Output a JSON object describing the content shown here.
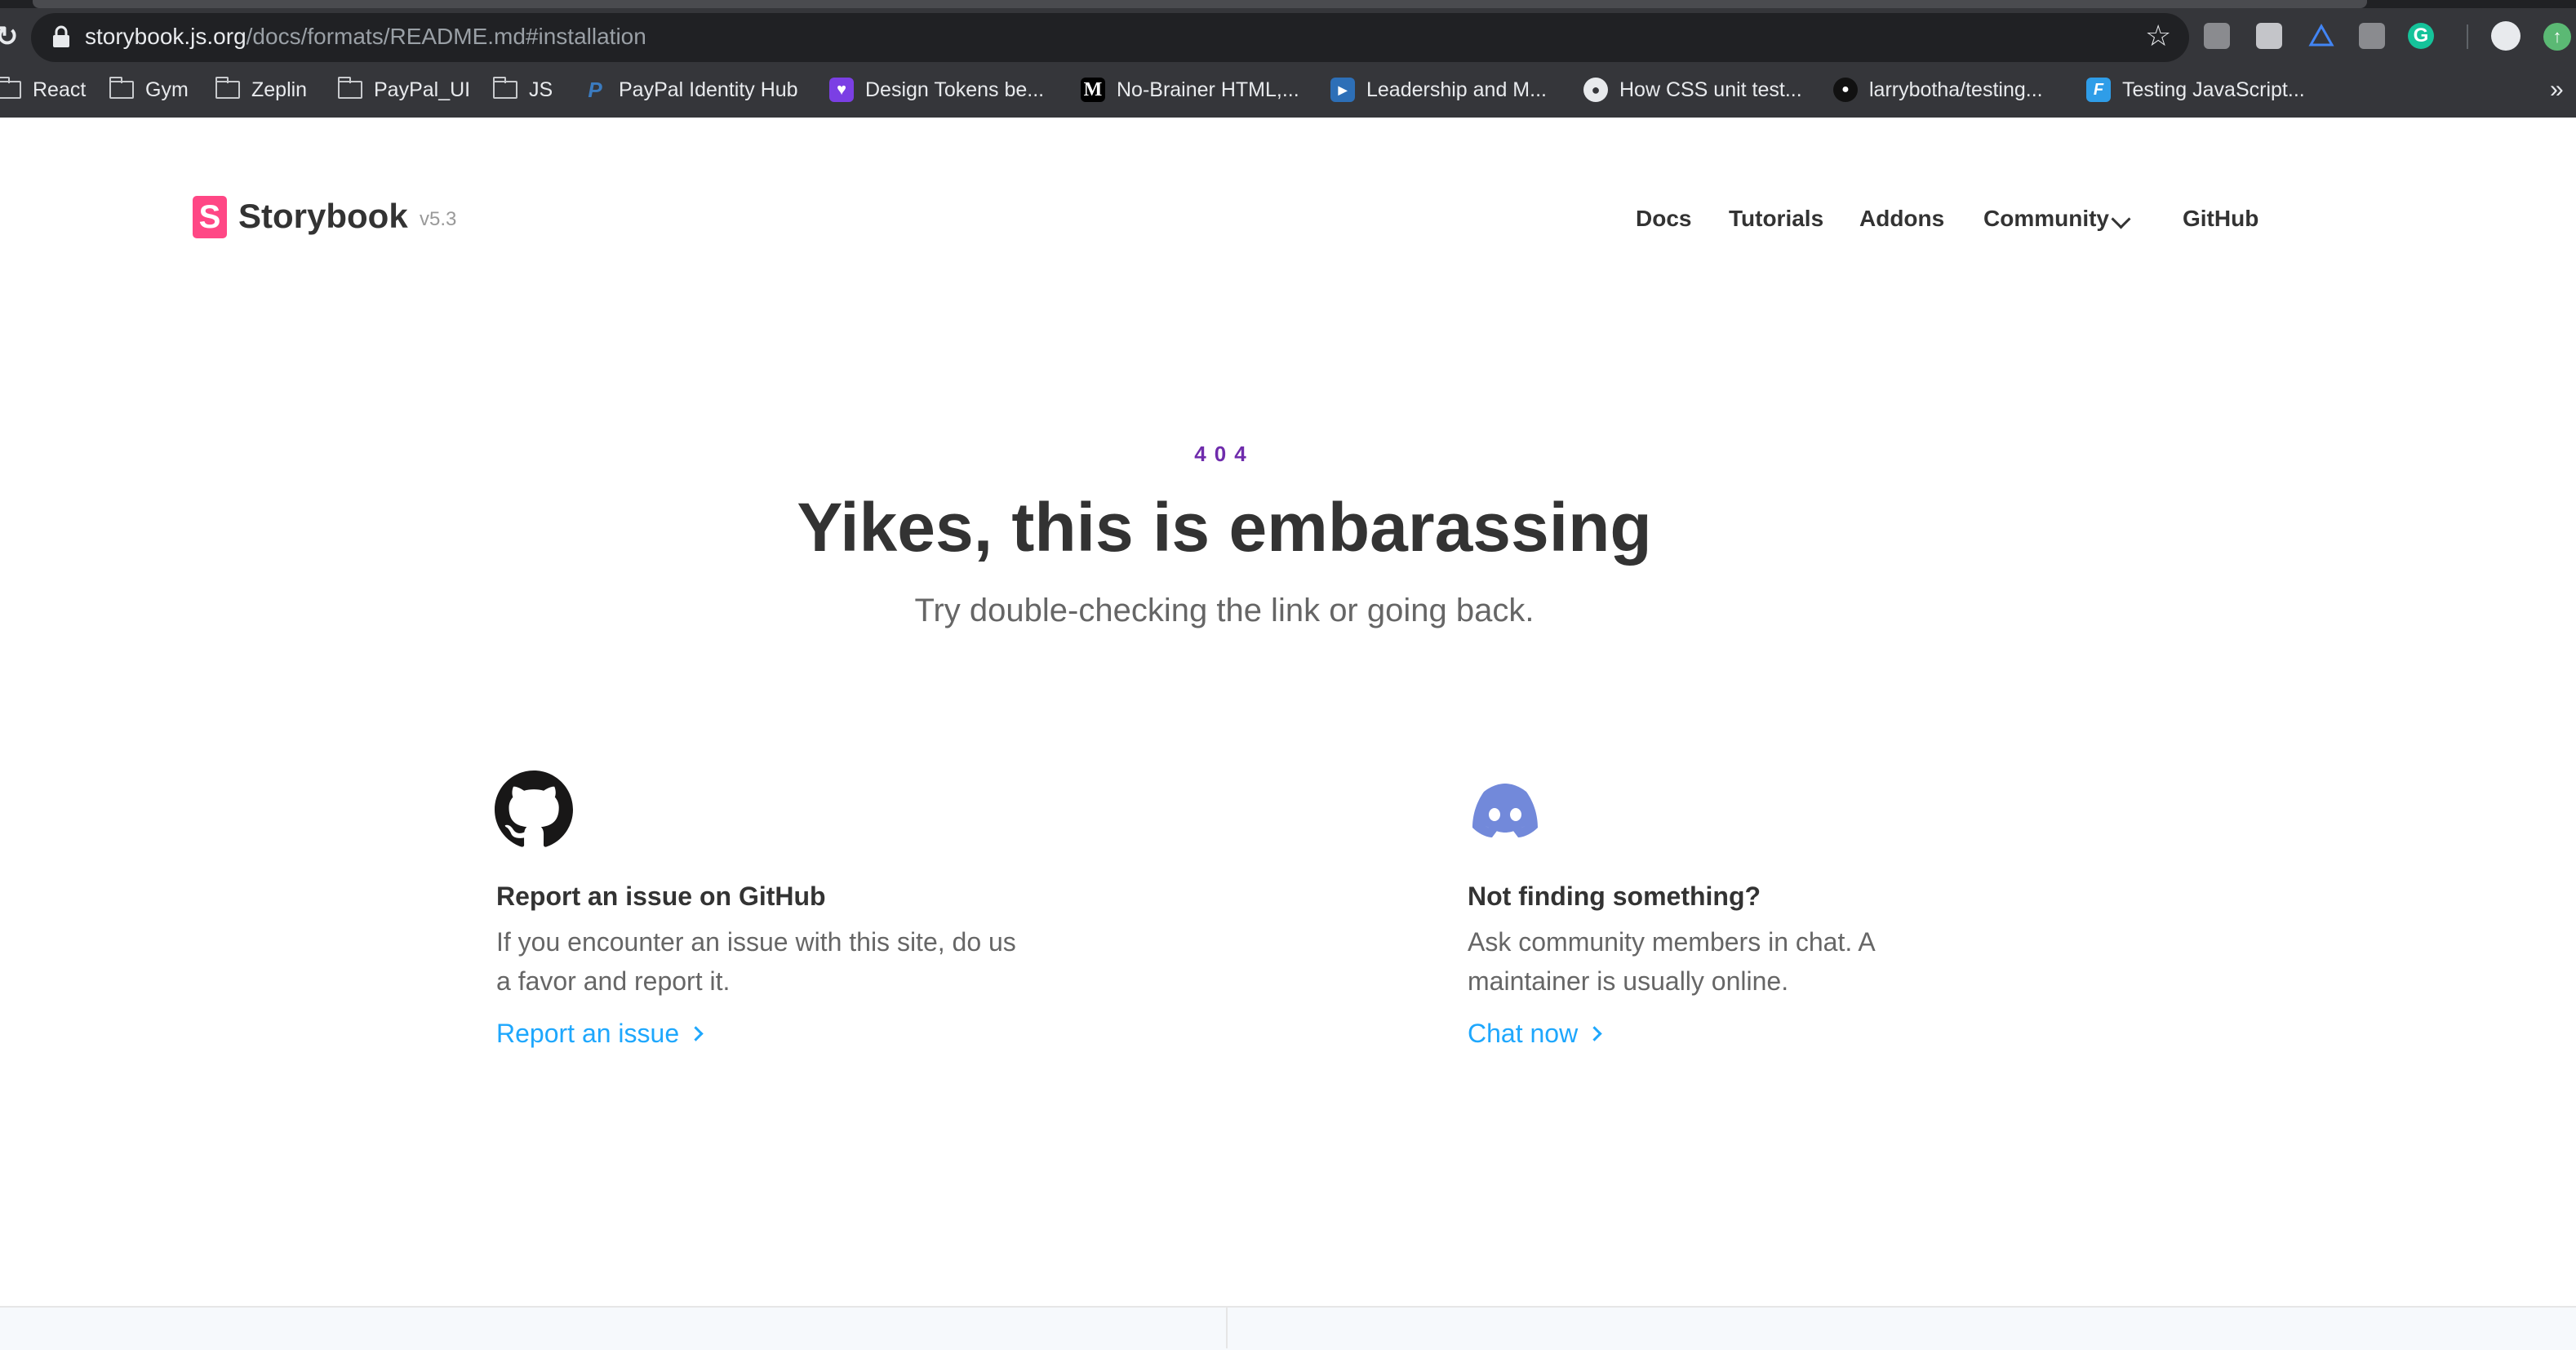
{
  "browser": {
    "url_host": "storybook.js.org",
    "url_path": "/docs/formats/README.md#installation",
    "bookmarks": [
      {
        "label": "React",
        "icon": "folder-icon"
      },
      {
        "label": "Gym",
        "icon": "folder-icon"
      },
      {
        "label": "Zeplin",
        "icon": "folder-icon"
      },
      {
        "label": "PayPal_UI",
        "icon": "folder-icon"
      },
      {
        "label": "JS",
        "icon": "folder-icon"
      },
      {
        "label": "PayPal Identity Hub",
        "icon": "paypal-icon"
      },
      {
        "label": "Design Tokens be...",
        "icon": "pocket-icon"
      },
      {
        "label": "No-Brainer HTML,...",
        "icon": "medium-icon"
      },
      {
        "label": "Leadership and M...",
        "icon": "video-icon"
      },
      {
        "label": "How CSS unit test...",
        "icon": "globe-icon"
      },
      {
        "label": "larrybotha/testing...",
        "icon": "github-icon"
      },
      {
        "label": "Testing JavaScript...",
        "icon": "frontend-masters-icon"
      }
    ]
  },
  "header": {
    "brand": "Storybook",
    "version": "v5.3",
    "logo_letter": "S",
    "nav": {
      "docs": "Docs",
      "tutorials": "Tutorials",
      "addons": "Addons",
      "community": "Community",
      "github": "GitHub"
    }
  },
  "hero": {
    "code": "404",
    "title": "Yikes, this is embarassing",
    "subtitle": "Try double-checking the link or going back."
  },
  "cards": [
    {
      "icon": "github-icon",
      "title": "Report an issue on GitHub",
      "text": "If you encounter an issue with this site, do us a favor and report it.",
      "link": "Report an issue"
    },
    {
      "icon": "discord-icon",
      "title": "Not finding something?",
      "text": "Ask community members in chat. A maintainer is usually online.",
      "link": "Chat now"
    }
  ],
  "colors": {
    "accent_pink": "#ff4785",
    "code_purple": "#6f2cac",
    "link_blue": "#1ea7fd",
    "discord_blue": "#7289da"
  }
}
